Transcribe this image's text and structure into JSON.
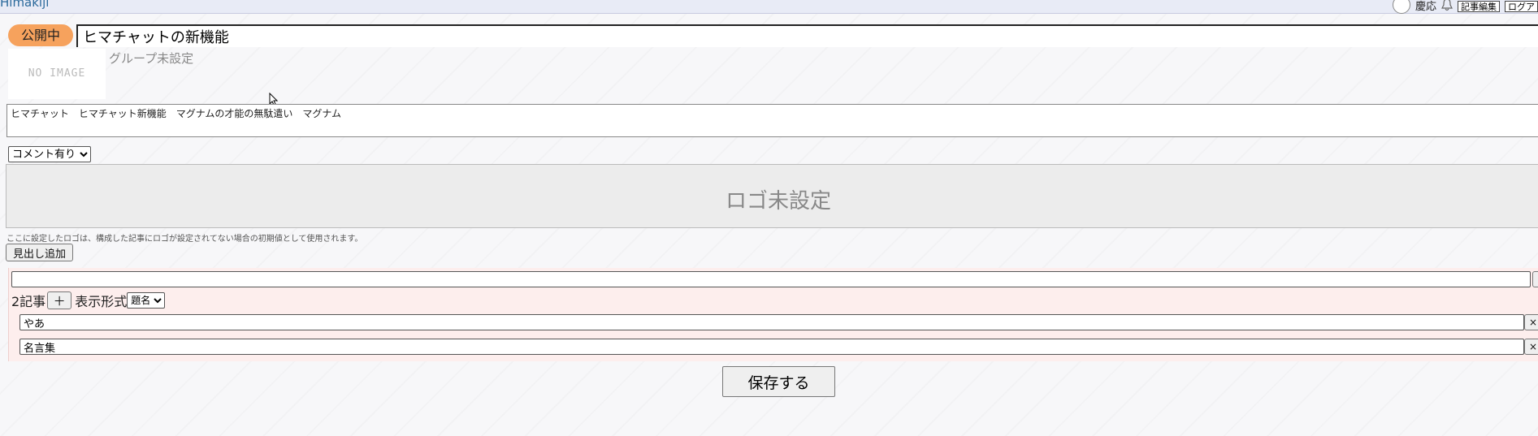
{
  "header": {
    "brand": "Himakiji",
    "user_name": "慶応",
    "edit_button": "記事編集",
    "logout_button": "ログア"
  },
  "article": {
    "status": "公開中",
    "title": "ヒマチャットの新機能",
    "thumbnail_text": "NO IMAGE",
    "group": "グループ未設定",
    "tags": "ヒマチャット　ヒマチャット新機能　マグナムの才能の無駄遣い　マグナム",
    "comment_setting": "コメント有り"
  },
  "logo": {
    "placeholder": "ロゴ未設定",
    "note": "ここに設定したロゴは、構成した記事にロゴが設定されてない場合の初期値として使用されます。"
  },
  "headings": {
    "add_button": "見出し追加",
    "section": {
      "heading_value": "",
      "count_label": "2記事",
      "plus_label": "＋",
      "format_label": "表示形式",
      "format_value": "題名",
      "articles": [
        "やあ",
        "名言集"
      ],
      "remove_label": "×"
    }
  },
  "save_button": "保存する"
}
